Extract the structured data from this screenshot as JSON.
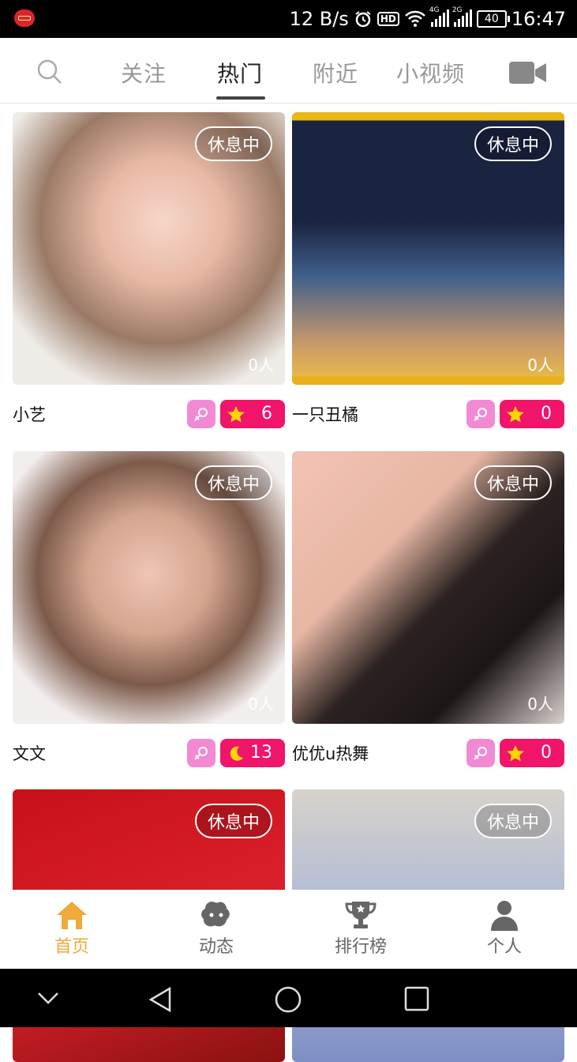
{
  "status_bar": {
    "speed": "12 B/s",
    "network1": "4G",
    "network2": "2G",
    "battery": "40",
    "time": "16:47"
  },
  "top_nav": {
    "tabs": [
      {
        "label": "关注"
      },
      {
        "label": "热门"
      },
      {
        "label": "附近"
      },
      {
        "label": "小视频"
      }
    ],
    "active_tab": "热门"
  },
  "cards": [
    {
      "name": "小艺",
      "status": "休息中",
      "viewers": "0人",
      "level": "6",
      "level_icon": "star-icon",
      "gender_icon": "female-icon"
    },
    {
      "name": "一只丑橘",
      "status": "休息中",
      "viewers": "0人",
      "level": "0",
      "level_icon": "star-icon",
      "gender_icon": "female-icon"
    },
    {
      "name": "文文",
      "status": "休息中",
      "viewers": "0人",
      "level": "13",
      "level_icon": "moon-icon",
      "gender_icon": "female-icon"
    },
    {
      "name": "优优u热舞",
      "status": "休息中",
      "viewers": "0人",
      "level": "0",
      "level_icon": "star-icon",
      "gender_icon": "female-icon"
    },
    {
      "name": "",
      "status": "休息中",
      "viewers": "",
      "level": "",
      "level_icon": "",
      "gender_icon": ""
    },
    {
      "name": "",
      "status": "休息中",
      "viewers": "",
      "level": "",
      "level_icon": "",
      "gender_icon": ""
    }
  ],
  "bottom_tabs": [
    {
      "label": "首页",
      "icon": "home-icon"
    },
    {
      "label": "动态",
      "icon": "moments-icon"
    },
    {
      "label": "排行榜",
      "icon": "trophy-icon"
    },
    {
      "label": "个人",
      "icon": "person-icon"
    }
  ],
  "colors": {
    "accent": "#f0a93a",
    "level_badge": "#f0146a",
    "gender_badge": "#f28ad3"
  }
}
